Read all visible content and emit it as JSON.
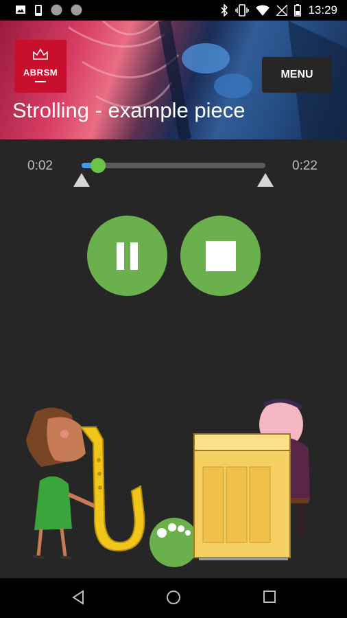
{
  "status_bar": {
    "time": "13:29",
    "left_icons": [
      "image-icon",
      "phone-icon",
      "circle-icon",
      "circle-icon"
    ],
    "right_icons": [
      "bluetooth-icon",
      "vibrate-icon",
      "wifi-icon",
      "no-signal-icon",
      "battery-icon"
    ]
  },
  "header": {
    "logo_text": "ABRSM",
    "menu_label": "MENU",
    "title": "Strolling - example piece"
  },
  "player": {
    "elapsed": "0:02",
    "total": "0:22",
    "progress_fraction": 0.09,
    "controls": [
      "pause-icon",
      "stop-icon"
    ]
  },
  "colors": {
    "brand_red": "#c8102e",
    "play_green": "#6ab04c",
    "progress_blue": "#3d9be9",
    "thumb_green": "#6cc24a",
    "background": "#262626"
  },
  "nav_bar": {
    "icons": [
      "back-icon",
      "home-icon",
      "recents-icon"
    ]
  }
}
